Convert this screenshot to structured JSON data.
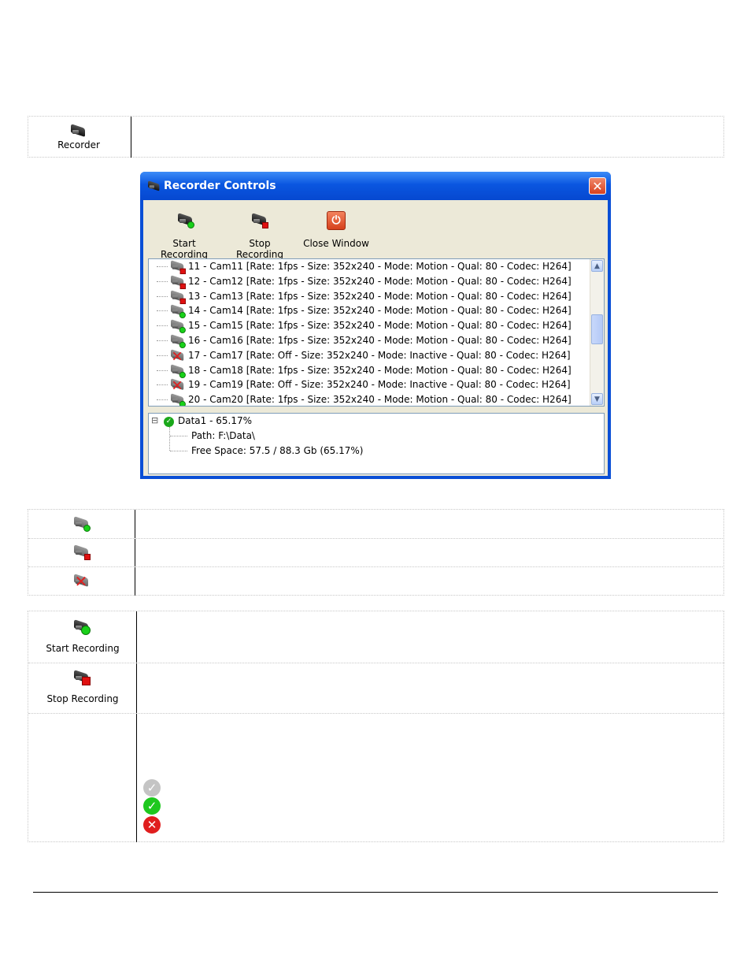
{
  "top_table": {
    "recorder_label": "Recorder"
  },
  "dialog": {
    "title": "Recorder Controls",
    "close_glyph": "✕",
    "toolbar": [
      {
        "label": "Start Recording",
        "icon": "camera-start-icon"
      },
      {
        "label": "Stop Recording",
        "icon": "camera-stop-icon"
      },
      {
        "label": "Close Window",
        "icon": "power-icon"
      }
    ],
    "cameras": [
      {
        "text": "11 - Cam11 [Rate: 1fps - Size: 352x240 - Mode: Motion - Qual: 80 - Codec: H264]",
        "status": "stopped"
      },
      {
        "text": "12 - Cam12 [Rate: 1fps - Size: 352x240 - Mode: Motion - Qual: 80 - Codec: H264]",
        "status": "stopped"
      },
      {
        "text": "13 - Cam13 [Rate: 1fps - Size: 352x240 - Mode: Motion - Qual: 80 - Codec: H264]",
        "status": "stopped"
      },
      {
        "text": "14 - Cam14 [Rate: 1fps - Size: 352x240 - Mode: Motion - Qual: 80 - Codec: H264]",
        "status": "recording"
      },
      {
        "text": "15 - Cam15 [Rate: 1fps - Size: 352x240 - Mode: Motion - Qual: 80 - Codec: H264]",
        "status": "recording"
      },
      {
        "text": "16 - Cam16 [Rate: 1fps - Size: 352x240 - Mode: Motion - Qual: 80 - Codec: H264]",
        "status": "recording"
      },
      {
        "text": "17 - Cam17 [Rate: Off - Size: 352x240 - Mode: Inactive - Qual: 80 - Codec: H264]",
        "status": "inactive"
      },
      {
        "text": "18 - Cam18 [Rate: 1fps - Size: 352x240 - Mode: Motion - Qual: 80 - Codec: H264]",
        "status": "recording"
      },
      {
        "text": "19 - Cam19 [Rate: Off - Size: 352x240 - Mode: Inactive - Qual: 80 - Codec: H264]",
        "status": "inactive"
      },
      {
        "text": "20 - Cam20 [Rate: 1fps - Size: 352x240 - Mode: Motion - Qual: 80 - Codec: H264]",
        "status": "recording"
      }
    ],
    "storage": {
      "expander": "⊟",
      "name": "Data1 - 65.17%",
      "path": "Path: F:\\Data\\",
      "free_space": "Free Space: 57.5 / 88.3 Gb  (65.17%)"
    }
  },
  "legend_table": [
    {
      "icon": "camera-recording-icon"
    },
    {
      "icon": "camera-stopped-icon"
    },
    {
      "icon": "camera-inactive-icon"
    }
  ],
  "buttons_table": {
    "start_label": "Start Recording",
    "stop_label": "Stop Recording",
    "status_icons": [
      {
        "icon": "grey-check-icon",
        "glyph": "✓",
        "color": "#c4c4c4"
      },
      {
        "icon": "green-check-icon",
        "glyph": "✓",
        "color": "#1ec81e"
      },
      {
        "icon": "red-x-icon",
        "glyph": "✕",
        "color": "#e01e1e"
      }
    ]
  },
  "colors": {
    "titlebar": "#0a56e0",
    "client": "#ece9d8"
  }
}
